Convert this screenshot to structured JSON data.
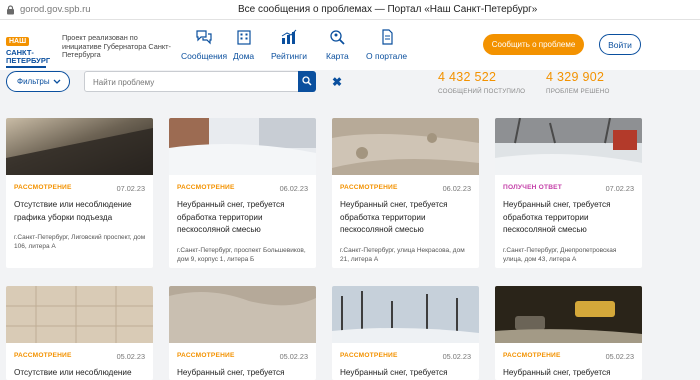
{
  "browser": {
    "url": "gorod.gov.spb.ru",
    "window_title": "Все сообщения о проблемах — Портал «Наш Санкт-Петербург»"
  },
  "header": {
    "logo_top": "НАШ",
    "logo_bottom": "САНКТ-ПЕТЕРБУРГ",
    "tagline": "Проект реализован по инициативе Губернатора Санкт-Петербурга",
    "nav": [
      {
        "label": "Сообщения",
        "icon": "chat-bubbles-icon"
      },
      {
        "label": "Дома",
        "icon": "building-icon"
      },
      {
        "label": "Рейтинги",
        "icon": "bar-chart-icon"
      },
      {
        "label": "Карта",
        "icon": "map-search-icon"
      },
      {
        "label": "О портале",
        "icon": "document-icon"
      }
    ],
    "report_button": "Сообщить о проблеме",
    "login_button": "Войти"
  },
  "toolbar": {
    "filters_label": "Фильтры",
    "search_placeholder": "Найти проблему",
    "clear_symbol": "✖"
  },
  "stats": [
    {
      "number": "4 432 522",
      "caption": "СООБЩЕНИЙ ПОСТУПИЛО"
    },
    {
      "number": "4 329 902",
      "caption": "ПРОБЛЕМ РЕШЕНО"
    }
  ],
  "colors": {
    "brand_blue": "#0a4f9e",
    "accent_orange": "#f39200",
    "status_review": "#f39200",
    "status_answered": "#c43ea8"
  },
  "cards": [
    {
      "status": "РАССМОТРЕНИЕ",
      "status_color": "#f39200",
      "date": "07.02.23",
      "title": "Отсутствие или несоблюдение графика уборки подъезда",
      "address": "г.Санкт-Петербург, Лиговский проспект, дом 106, литера А"
    },
    {
      "status": "РАССМОТРЕНИЕ",
      "status_color": "#f39200",
      "date": "06.02.23",
      "title": "Неубранный снег, требуется обработка территории пескосоляной смесью",
      "address": "г.Санкт-Петербург, проспект Большевиков, дом 9, корпус 1, литера Б"
    },
    {
      "status": "РАССМОТРЕНИЕ",
      "status_color": "#f39200",
      "date": "06.02.23",
      "title": "Неубранный снег, требуется обработка территории пескосоляной смесью",
      "address": "г.Санкт-Петербург, улица Некрасова, дом 21, литера А"
    },
    {
      "status": "ПОЛУЧЕН ОТВЕТ",
      "status_color": "#c43ea8",
      "date": "07.02.23",
      "title": "Неубранный снег, требуется обработка территории пескосоляной смесью",
      "address": "г.Санкт-Петербург, Днепропетровская улица, дом 43, литера А"
    },
    {
      "status": "РАССМОТРЕНИЕ",
      "status_color": "#f39200",
      "date": "05.02.23",
      "title": "Отсутствие или несоблюдение",
      "address": ""
    },
    {
      "status": "РАССМОТРЕНИЕ",
      "status_color": "#f39200",
      "date": "05.02.23",
      "title": "Неубранный снег, требуется",
      "address": ""
    },
    {
      "status": "РАССМОТРЕНИЕ",
      "status_color": "#f39200",
      "date": "05.02.23",
      "title": "Неубранный снег, требуется",
      "address": ""
    },
    {
      "status": "РАССМОТРЕНИЕ",
      "status_color": "#f39200",
      "date": "05.02.23",
      "title": "Неубранный снег, требуется",
      "address": ""
    }
  ]
}
